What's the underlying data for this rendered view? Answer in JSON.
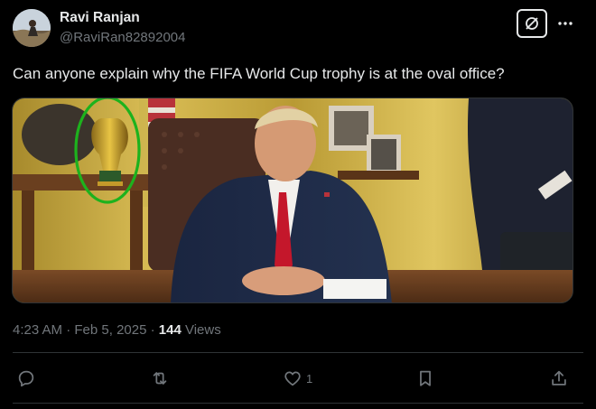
{
  "author": {
    "display_name": "Ravi Ranjan",
    "handle": "@RaviRan82892004",
    "avatar_icon": "profile-photo"
  },
  "header_actions": {
    "grok_icon": "grok-icon",
    "more_icon": "more-dots-icon"
  },
  "tweet": {
    "text": "Can anyone explain why the FIFA World Cup trophy is at the oval office?",
    "media_description_icon": "photo"
  },
  "meta": {
    "time": "4:23 AM",
    "separator1": " · ",
    "date": "Feb 5, 2025",
    "separator2": " · ",
    "views_count": "144",
    "views_label": " Views"
  },
  "actions": {
    "reply_count": "",
    "repost_count": "",
    "like_count": "1",
    "bookmark_count": "",
    "share_count": ""
  },
  "colors": {
    "background": "#000000",
    "text": "#e7e9ea",
    "secondary": "#71767b",
    "divider": "#2f3336",
    "highlight_circle": "#1db21d"
  }
}
